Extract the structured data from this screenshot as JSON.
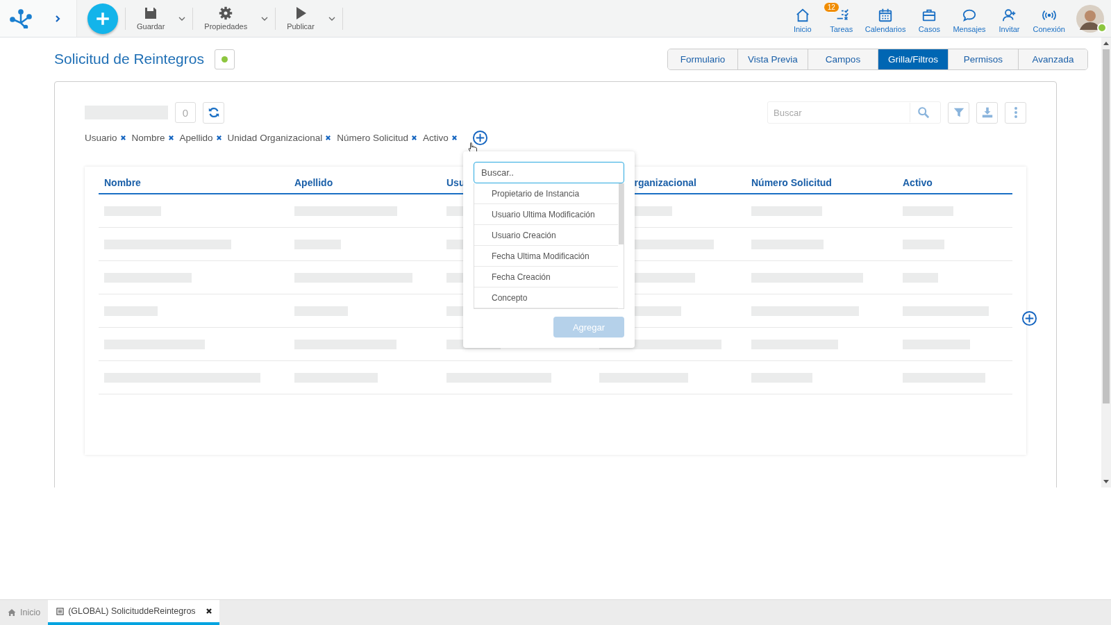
{
  "toolbar": {
    "left": [
      {
        "label": "Guardar",
        "kind": "save"
      },
      {
        "label": "Propiedades",
        "kind": "properties"
      },
      {
        "label": "Publicar",
        "kind": "publish"
      }
    ],
    "right": [
      {
        "label": "Inicio",
        "kind": "home"
      },
      {
        "label": "Tareas",
        "kind": "tasks",
        "badge": "12"
      },
      {
        "label": "Calendarios",
        "kind": "calendar"
      },
      {
        "label": "Casos",
        "kind": "cases"
      },
      {
        "label": "Mensajes",
        "kind": "messages"
      },
      {
        "label": "Invitar",
        "kind": "invite"
      },
      {
        "label": "Conexión",
        "kind": "connection"
      }
    ],
    "user": {
      "online": true
    }
  },
  "page": {
    "title": "Solicitud de Reintegros"
  },
  "tabs": [
    {
      "label": "Formulario",
      "selected": false
    },
    {
      "label": "Vista Previa",
      "selected": false
    },
    {
      "label": "Campos",
      "selected": false
    },
    {
      "label": "Grilla/Filtros",
      "selected": true
    },
    {
      "label": "Permisos",
      "selected": false
    },
    {
      "label": "Avanzada",
      "selected": false
    }
  ],
  "grid_toolbar": {
    "count": "0",
    "search_placeholder": "Buscar"
  },
  "filters": [
    "Usuario",
    "Nombre",
    "Apellido",
    "Unidad Organizacional",
    "Número Solicitud",
    "Activo"
  ],
  "table": {
    "columns": [
      "Nombre",
      "Apellido",
      "Usu",
      "rganizacional",
      "Número Solicitud",
      "Activo"
    ]
  },
  "add_field_popup": {
    "search_placeholder": "Buscar..",
    "options": [
      "Propietario de Instancia",
      "Usuario Ultima Modificación",
      "Usuario Creación",
      "Fecha Ultima Modificación",
      "Fecha Creación",
      "Concepto"
    ],
    "add_button": {
      "label": "Agregar",
      "disabled": true
    }
  },
  "taskbar": {
    "tabs": [
      {
        "label": "Inicio",
        "kind": "home",
        "selected": false,
        "closable": false
      },
      {
        "label": "(GLOBAL) SolicituddeReintegros",
        "kind": "form",
        "selected": true,
        "closable": true
      }
    ]
  }
}
